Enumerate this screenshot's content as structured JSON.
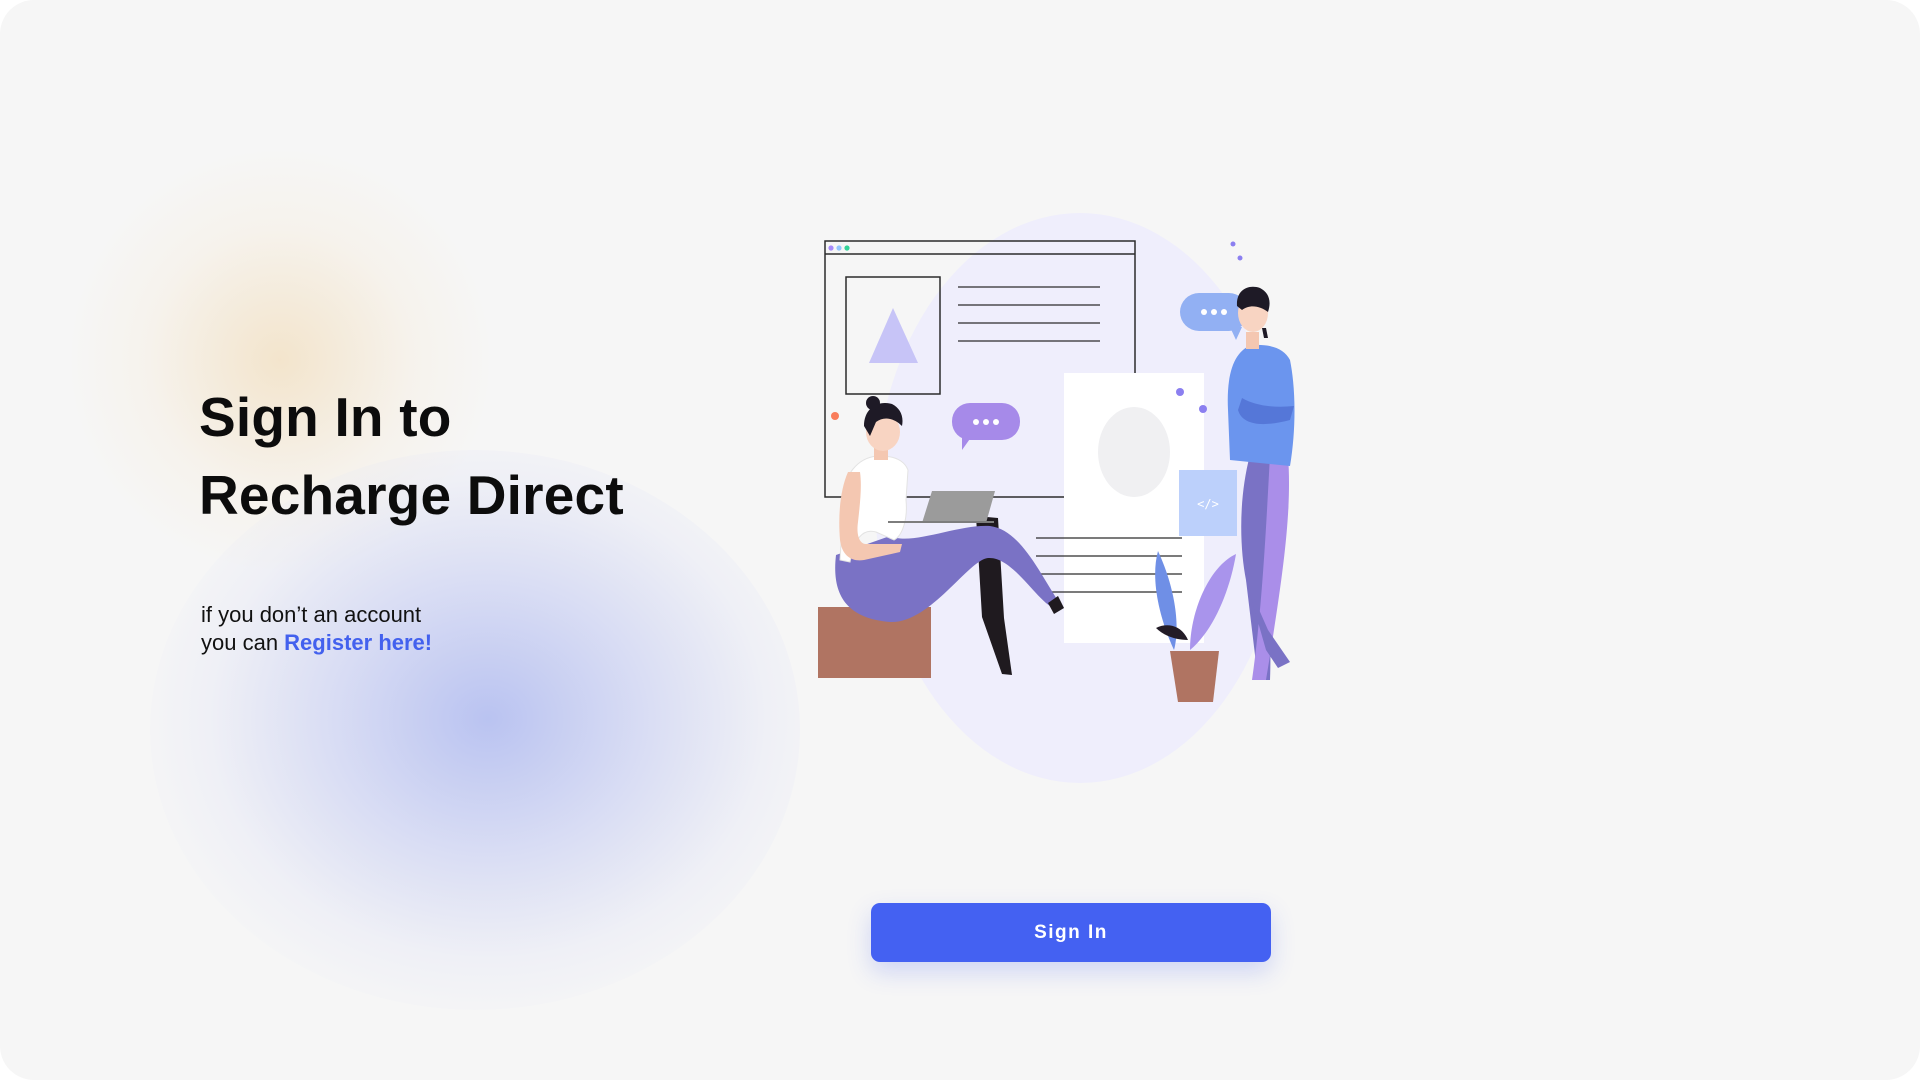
{
  "hero": {
    "title_line1": "Sign In to",
    "title_line2": "Recharge Direct",
    "subtitle_line1": "if you don’t an account",
    "subtitle_line2_prefix": "you can ",
    "register_link": "Register here!"
  },
  "illustration": {
    "code_tag": "</>"
  },
  "actions": {
    "sign_in_label": "Sign In"
  },
  "colors": {
    "accent": "#4461f2",
    "link": "#4361ee",
    "background": "#f6f6f6",
    "title": "#0c0c0c"
  }
}
